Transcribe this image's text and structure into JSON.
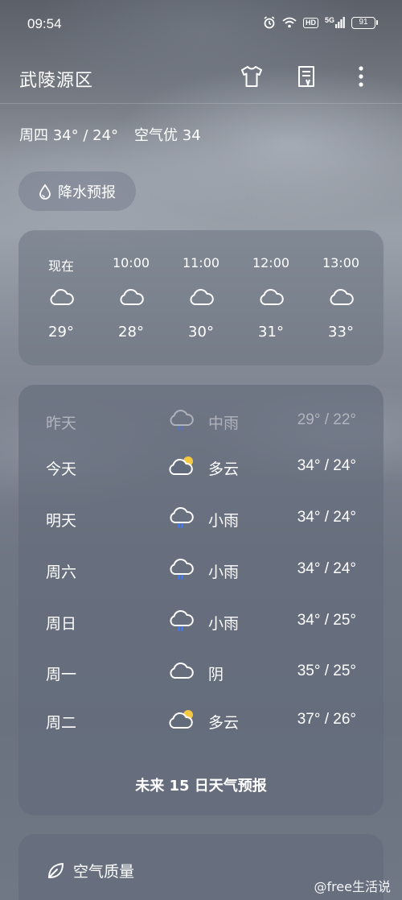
{
  "status_bar": {
    "time": "09:54",
    "network_label": "5G",
    "hd_label": "HD",
    "battery_level": "91"
  },
  "header": {
    "city": "武陵源区",
    "icons": [
      "tshirt-icon",
      "document-icon",
      "more-vertical-icon"
    ]
  },
  "summary": {
    "day_temps": "周四 34° / 24°",
    "air": "空气优 34"
  },
  "rain_button": {
    "label": "降水预报",
    "icon": "raindrop-icon"
  },
  "hourly": [
    {
      "time": "现在",
      "icon": "cloud-icon",
      "temp": "29°"
    },
    {
      "time": "10:00",
      "icon": "cloud-icon",
      "temp": "28°"
    },
    {
      "time": "11:00",
      "icon": "cloud-icon",
      "temp": "30°"
    },
    {
      "time": "12:00",
      "icon": "cloud-icon",
      "temp": "31°"
    },
    {
      "time": "13:00",
      "icon": "cloud-icon",
      "temp": "33°"
    }
  ],
  "daily": [
    {
      "day": "昨天",
      "icon": "rain-cloud-icon",
      "condition": "中雨",
      "temps": "29° / 22°"
    },
    {
      "day": "今天",
      "icon": "partly-cloudy-icon",
      "condition": "多云",
      "temps": "34° / 24°"
    },
    {
      "day": "明天",
      "icon": "rain-cloud-icon",
      "condition": "小雨",
      "temps": "34° / 24°"
    },
    {
      "day": "周六",
      "icon": "rain-cloud-icon",
      "condition": "小雨",
      "temps": "34° / 24°"
    },
    {
      "day": "周日",
      "icon": "rain-cloud-icon",
      "condition": "小雨",
      "temps": "34° / 25°"
    },
    {
      "day": "周一",
      "icon": "cloud-icon",
      "condition": "阴",
      "temps": "35° / 25°"
    },
    {
      "day": "周二",
      "icon": "partly-cloudy-icon",
      "condition": "多云",
      "temps": "37° / 26°"
    }
  ],
  "forecast_link": "未来 15 日天气预报",
  "air_quality": {
    "title": "空气质量",
    "icon": "leaf-icon"
  },
  "watermark": "@free生活说",
  "colors": {
    "sun": "#f5c842",
    "rain": "#3b7bff"
  }
}
